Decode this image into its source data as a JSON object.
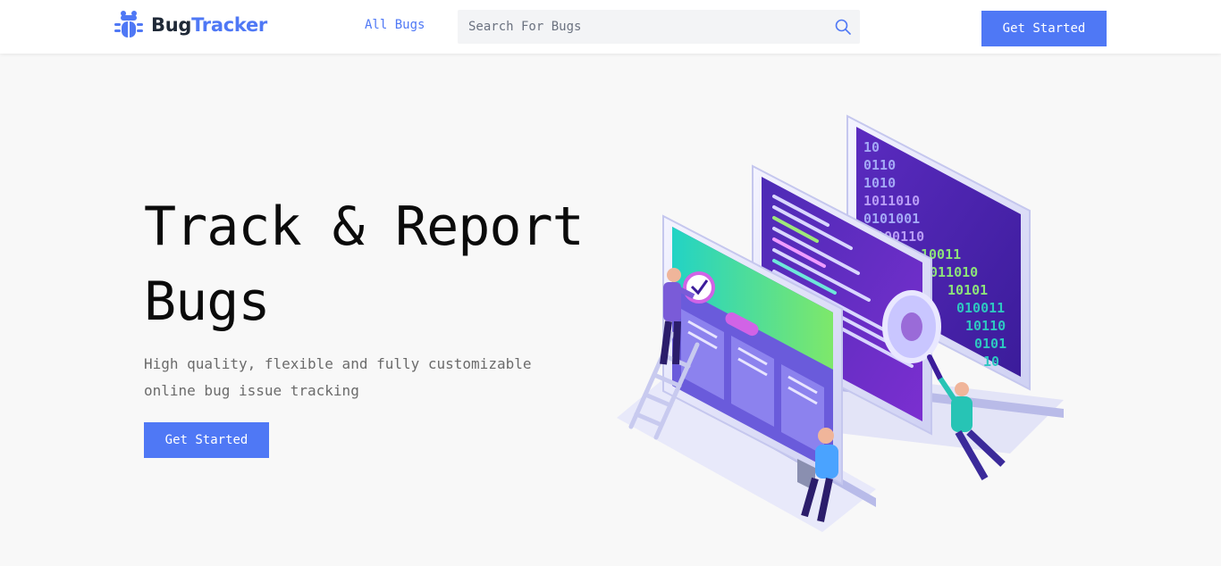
{
  "header": {
    "brand": {
      "part1": "Bug",
      "part2": "Tracker"
    },
    "nav_all_bugs": "All Bugs",
    "search_placeholder": "Search For Bugs",
    "cta_label": "Get Started"
  },
  "hero": {
    "title": "Track & Report Bugs",
    "subtitle": "High quality, flexible and fully customizable online bug issue tracking",
    "cta_label": "Get Started"
  },
  "colors": {
    "accent": "#4f78f5",
    "page_bg": "#f8f8f8",
    "header_bg": "#ffffff"
  },
  "icons": {
    "logo": "bug-icon",
    "search": "search-icon"
  }
}
